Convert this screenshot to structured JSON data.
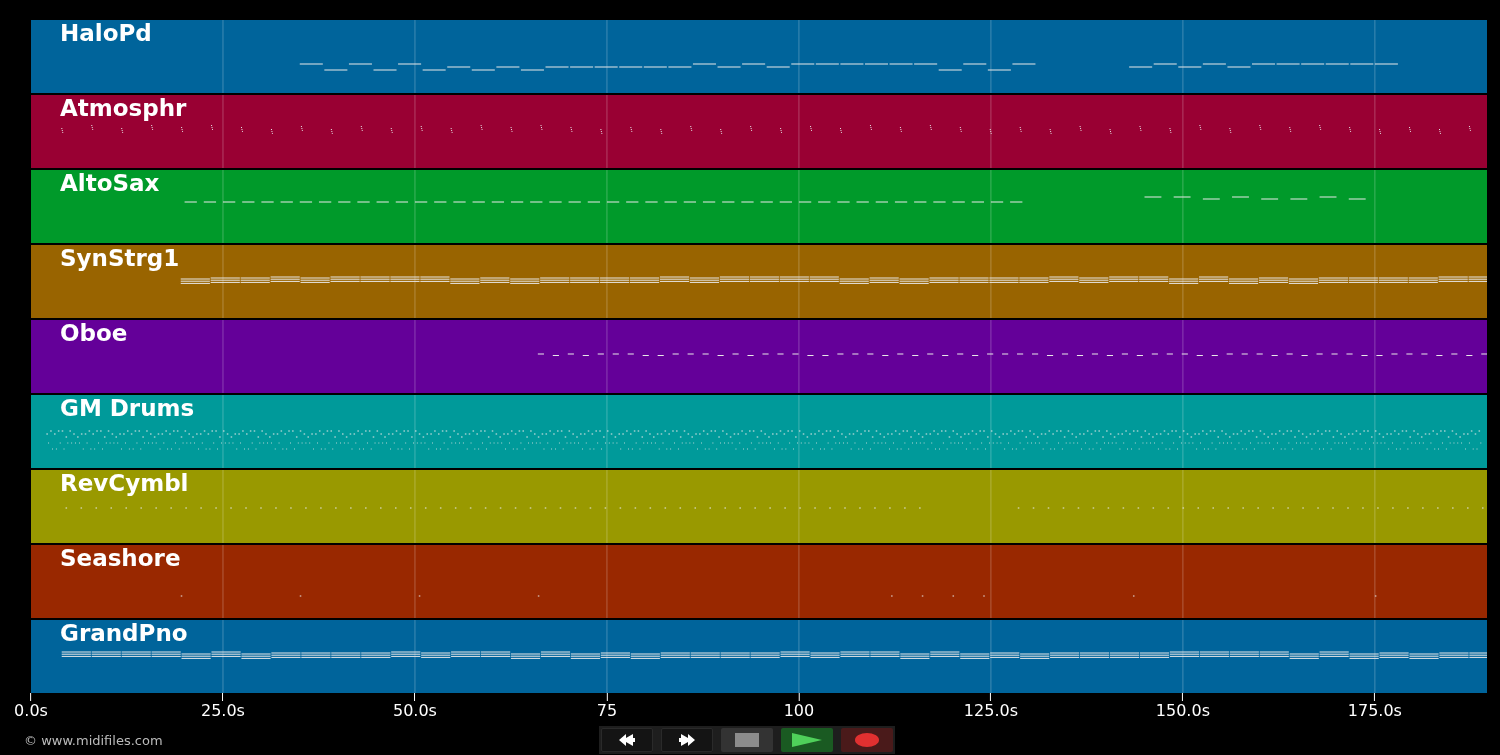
{
  "tracks": [
    {
      "name": "HaloPd",
      "color": "#00649b",
      "kind": "pad"
    },
    {
      "name": "Atmosphr",
      "color": "#990033",
      "kind": "ticks"
    },
    {
      "name": "AltoSax",
      "color": "#009a2a",
      "kind": "melody"
    },
    {
      "name": "SynStrg1",
      "color": "#996400",
      "kind": "chords"
    },
    {
      "name": "Oboe",
      "color": "#640099",
      "kind": "dashes"
    },
    {
      "name": "GM Drums",
      "color": "#009a9a",
      "kind": "drums"
    },
    {
      "name": "RevCymbl",
      "color": "#999900",
      "kind": "dots"
    },
    {
      "name": "Seashore",
      "color": "#992800",
      "kind": "sparse"
    },
    {
      "name": "GrandPno",
      "color": "#00649b",
      "kind": "piano"
    }
  ],
  "axis": {
    "ticks": [
      "0.0s",
      "25.0s",
      "50.0s",
      "75",
      "100",
      "125.0s",
      "150.0s",
      "175.0s"
    ]
  },
  "credit": "© www.midifiles.com",
  "controls": [
    {
      "kind": "rewind"
    },
    {
      "kind": "forward"
    },
    {
      "kind": "stop"
    },
    {
      "kind": "play"
    },
    {
      "kind": "record"
    }
  ]
}
